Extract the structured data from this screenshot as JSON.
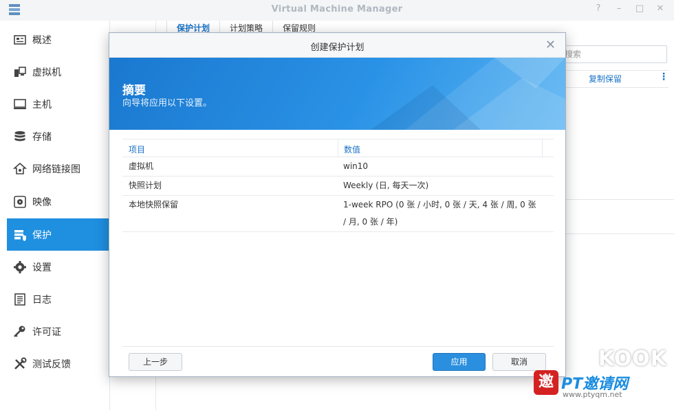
{
  "window": {
    "title": "Virtual Machine Manager"
  },
  "sidebar": {
    "items": [
      {
        "label": "概述",
        "icon": "overview-icon"
      },
      {
        "label": "虚拟机",
        "icon": "vm-icon"
      },
      {
        "label": "主机",
        "icon": "host-icon"
      },
      {
        "label": "存储",
        "icon": "storage-icon"
      },
      {
        "label": "网络链接图",
        "icon": "network-icon"
      },
      {
        "label": "映像",
        "icon": "image-icon"
      },
      {
        "label": "保护",
        "icon": "protection-icon",
        "active": true
      },
      {
        "label": "设置",
        "icon": "settings-icon"
      },
      {
        "label": "日志",
        "icon": "log-icon"
      },
      {
        "label": "许可证",
        "icon": "license-icon"
      },
      {
        "label": "测试反馈",
        "icon": "feedback-icon"
      }
    ]
  },
  "main": {
    "tabs": [
      {
        "label": "保护计划",
        "active": true
      },
      {
        "label": "计划策略"
      },
      {
        "label": "保留规则"
      }
    ],
    "search_placeholder": "搜索",
    "column_visible": "复制保留"
  },
  "dialog": {
    "title": "创建保护计划",
    "banner_title": "摘要",
    "banner_subtitle": "向导将应用以下设置。",
    "table": {
      "headers": [
        "项目",
        "数值"
      ],
      "rows": [
        {
          "item": "虚拟机",
          "value": "win10"
        },
        {
          "item": "快照计划",
          "value": "Weekly (日, 每天一次)"
        },
        {
          "item": "本地快照保留",
          "value_line1": "1-week RPO (0 张 / 小时, 0 张 / 天, 4 张 / 周, 0 张",
          "value_line2": "/ 月, 0 张 / 年)"
        }
      ]
    },
    "buttons": {
      "prev": "上一步",
      "apply": "应用",
      "cancel": "取消"
    }
  },
  "watermark": {
    "brand": "KOOK",
    "badge": "邀",
    "text": "PT邀请网",
    "url": "www.ptyqm.net"
  },
  "colors": {
    "accent": "#1f8fe0",
    "banner": "#2a92e6"
  }
}
